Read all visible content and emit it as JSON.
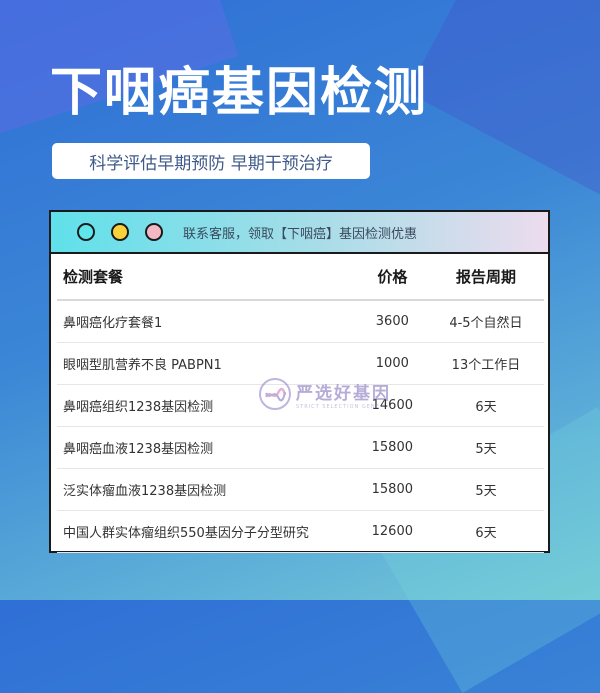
{
  "header": {
    "title": "下咽癌基因检测",
    "subtitle": "科学评估早期预防 早期干预治疗"
  },
  "card": {
    "notice": "联系客服，领取【下咽癌】基因检测优惠",
    "dots": [
      "#5fe6ea",
      "#f7d23a",
      "#f4b8c4"
    ]
  },
  "table": {
    "headers": [
      "检测套餐",
      "价格",
      "报告周期"
    ],
    "rows": [
      {
        "name": "鼻咽癌化疗套餐1",
        "price": "3600",
        "period": "4-5个自然日"
      },
      {
        "name": "眼咽型肌营养不良 PABPN1",
        "price": "1000",
        "period": "13个工作日"
      },
      {
        "name": "鼻咽癌组织1238基因检测",
        "price": "14600",
        "period": "6天"
      },
      {
        "name": "鼻咽癌血液1238基因检测",
        "price": "15800",
        "period": "5天"
      },
      {
        "name": "泛实体瘤血液1238基因检测",
        "price": "15800",
        "period": "5天"
      },
      {
        "name": "中国人群实体瘤组织550基因分子分型研究",
        "price": "12600",
        "period": "6天"
      }
    ]
  },
  "watermark": {
    "text": "严选好基因",
    "subtext": "STRICT SELECTION GENE"
  }
}
